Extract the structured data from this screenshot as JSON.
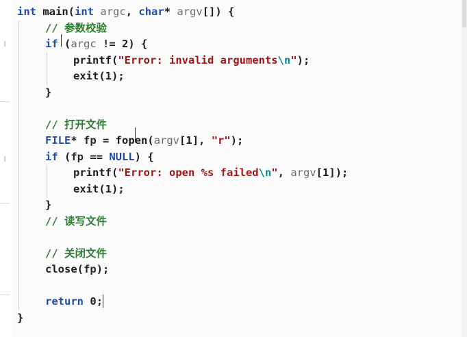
{
  "editor": {
    "lines": [
      {
        "indent": 0,
        "tokens": [
          {
            "c": "kw",
            "t": "int"
          },
          {
            "c": "punc",
            "t": " "
          },
          {
            "c": "fn",
            "t": "main"
          },
          {
            "c": "punc",
            "t": "("
          },
          {
            "c": "kw",
            "t": "int"
          },
          {
            "c": "punc",
            "t": " "
          },
          {
            "c": "param",
            "t": "argc"
          },
          {
            "c": "punc",
            "t": ", "
          },
          {
            "c": "kw",
            "t": "char"
          },
          {
            "c": "punc",
            "t": "* "
          },
          {
            "c": "param",
            "t": "argv"
          },
          {
            "c": "punc",
            "t": "[]) {"
          }
        ]
      },
      {
        "indent": 1,
        "tokens": [
          {
            "c": "cm",
            "t": "// 参数校验"
          }
        ]
      },
      {
        "indent": 1,
        "tokens": [
          {
            "c": "kw",
            "t": "if"
          },
          {
            "c": "punc",
            "t": " ("
          },
          {
            "c": "param",
            "t": "argc"
          },
          {
            "c": "punc",
            "t": " != "
          },
          {
            "c": "num",
            "t": "2"
          },
          {
            "c": "punc",
            "t": ") {"
          }
        ]
      },
      {
        "indent": 2,
        "tokens": [
          {
            "c": "fn",
            "t": "printf"
          },
          {
            "c": "punc",
            "t": "("
          },
          {
            "c": "str",
            "t": "\"Error: invalid arguments"
          },
          {
            "c": "esc",
            "t": "\\n"
          },
          {
            "c": "str",
            "t": "\""
          },
          {
            "c": "punc",
            "t": ");"
          }
        ]
      },
      {
        "indent": 2,
        "tokens": [
          {
            "c": "fn",
            "t": "exit"
          },
          {
            "c": "punc",
            "t": "("
          },
          {
            "c": "num",
            "t": "1"
          },
          {
            "c": "punc",
            "t": ");"
          }
        ]
      },
      {
        "indent": 1,
        "tokens": [
          {
            "c": "punc",
            "t": "}"
          }
        ]
      },
      {
        "indent": 1,
        "tokens": []
      },
      {
        "indent": 1,
        "tokens": [
          {
            "c": "cm",
            "t": "// 打开文件"
          }
        ]
      },
      {
        "indent": 1,
        "tokens": [
          {
            "c": "ty",
            "t": "FILE"
          },
          {
            "c": "punc",
            "t": "* "
          },
          {
            "c": "id",
            "t": "fp"
          },
          {
            "c": "punc",
            "t": " = "
          },
          {
            "c": "fn",
            "t": "fopen"
          },
          {
            "c": "punc",
            "t": "("
          },
          {
            "c": "param",
            "t": "argv"
          },
          {
            "c": "punc",
            "t": "["
          },
          {
            "c": "num",
            "t": "1"
          },
          {
            "c": "punc",
            "t": "], "
          },
          {
            "c": "str",
            "t": "\"r\""
          },
          {
            "c": "punc",
            "t": ");"
          }
        ]
      },
      {
        "indent": 1,
        "tokens": [
          {
            "c": "kw",
            "t": "if"
          },
          {
            "c": "punc",
            "t": " ("
          },
          {
            "c": "id",
            "t": "fp"
          },
          {
            "c": "punc",
            "t": " == "
          },
          {
            "c": "mac",
            "t": "NULL"
          },
          {
            "c": "punc",
            "t": ") {"
          }
        ]
      },
      {
        "indent": 2,
        "tokens": [
          {
            "c": "fn",
            "t": "printf"
          },
          {
            "c": "punc",
            "t": "("
          },
          {
            "c": "str",
            "t": "\"Error: open %s failed"
          },
          {
            "c": "esc",
            "t": "\\n"
          },
          {
            "c": "str",
            "t": "\""
          },
          {
            "c": "punc",
            "t": ", "
          },
          {
            "c": "param",
            "t": "argv"
          },
          {
            "c": "punc",
            "t": "["
          },
          {
            "c": "num",
            "t": "1"
          },
          {
            "c": "punc",
            "t": "]);"
          }
        ]
      },
      {
        "indent": 2,
        "tokens": [
          {
            "c": "fn",
            "t": "exit"
          },
          {
            "c": "punc",
            "t": "("
          },
          {
            "c": "num",
            "t": "1"
          },
          {
            "c": "punc",
            "t": ");"
          }
        ]
      },
      {
        "indent": 1,
        "tokens": [
          {
            "c": "punc",
            "t": "}"
          }
        ]
      },
      {
        "indent": 1,
        "tokens": [
          {
            "c": "cm",
            "t": "// 读写文件"
          }
        ]
      },
      {
        "indent": 1,
        "tokens": []
      },
      {
        "indent": 1,
        "tokens": [
          {
            "c": "cm",
            "t": "// 关闭文件"
          }
        ]
      },
      {
        "indent": 1,
        "tokens": [
          {
            "c": "fn",
            "t": "close"
          },
          {
            "c": "punc",
            "t": "("
          },
          {
            "c": "id",
            "t": "fp"
          },
          {
            "c": "punc",
            "t": ");"
          }
        ]
      },
      {
        "indent": 1,
        "tokens": []
      },
      {
        "indent": 1,
        "cursor": true,
        "tokens": [
          {
            "c": "kw",
            "t": "return"
          },
          {
            "c": "punc",
            "t": " "
          },
          {
            "c": "num",
            "t": "0"
          },
          {
            "c": "punc",
            "t": ";"
          }
        ]
      },
      {
        "indent": 0,
        "tokens": [
          {
            "c": "punc",
            "t": "}"
          }
        ]
      }
    ]
  },
  "colors": {
    "keyword": "#1f4aa8",
    "string": "#a31515",
    "comment": "#2e7d32",
    "escape": "#0e8a8a",
    "parameter": "#6b6b6b"
  }
}
